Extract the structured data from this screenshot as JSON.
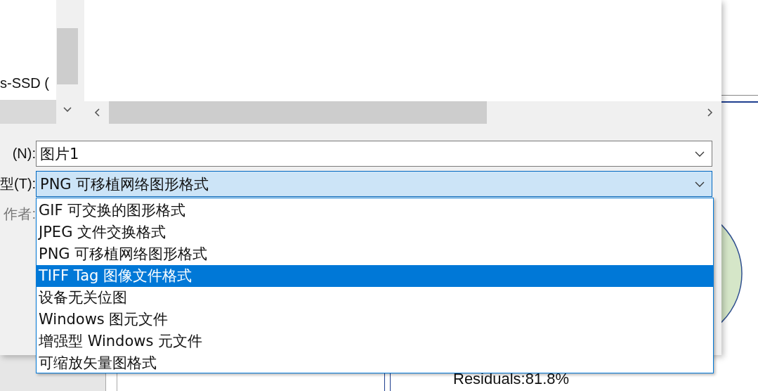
{
  "document": {
    "text": "Residuals:81.8%"
  },
  "dialog": {
    "folder_tree": {
      "items": [
        {
          "label": "s-SSD ("
        }
      ]
    },
    "file_name": {
      "label": "(N):",
      "value": "图片1"
    },
    "file_type": {
      "label": "型(T):",
      "value": "PNG 可移植网络图形格式",
      "expanded": true,
      "options": [
        {
          "label": "GIF 可交换的图形格式",
          "highlighted": false
        },
        {
          "label": "JPEG 文件交换格式",
          "highlighted": false
        },
        {
          "label": "PNG 可移植网络图形格式",
          "highlighted": false
        },
        {
          "label": "TIFF Tag 图像文件格式",
          "highlighted": true
        },
        {
          "label": "设备无关位图",
          "highlighted": false
        },
        {
          "label": "Windows 图元文件",
          "highlighted": false
        },
        {
          "label": "增强型 Windows 元文件",
          "highlighted": false
        },
        {
          "label": "可缩放矢量图格式",
          "highlighted": false
        }
      ]
    },
    "authors_label": "作者:"
  }
}
